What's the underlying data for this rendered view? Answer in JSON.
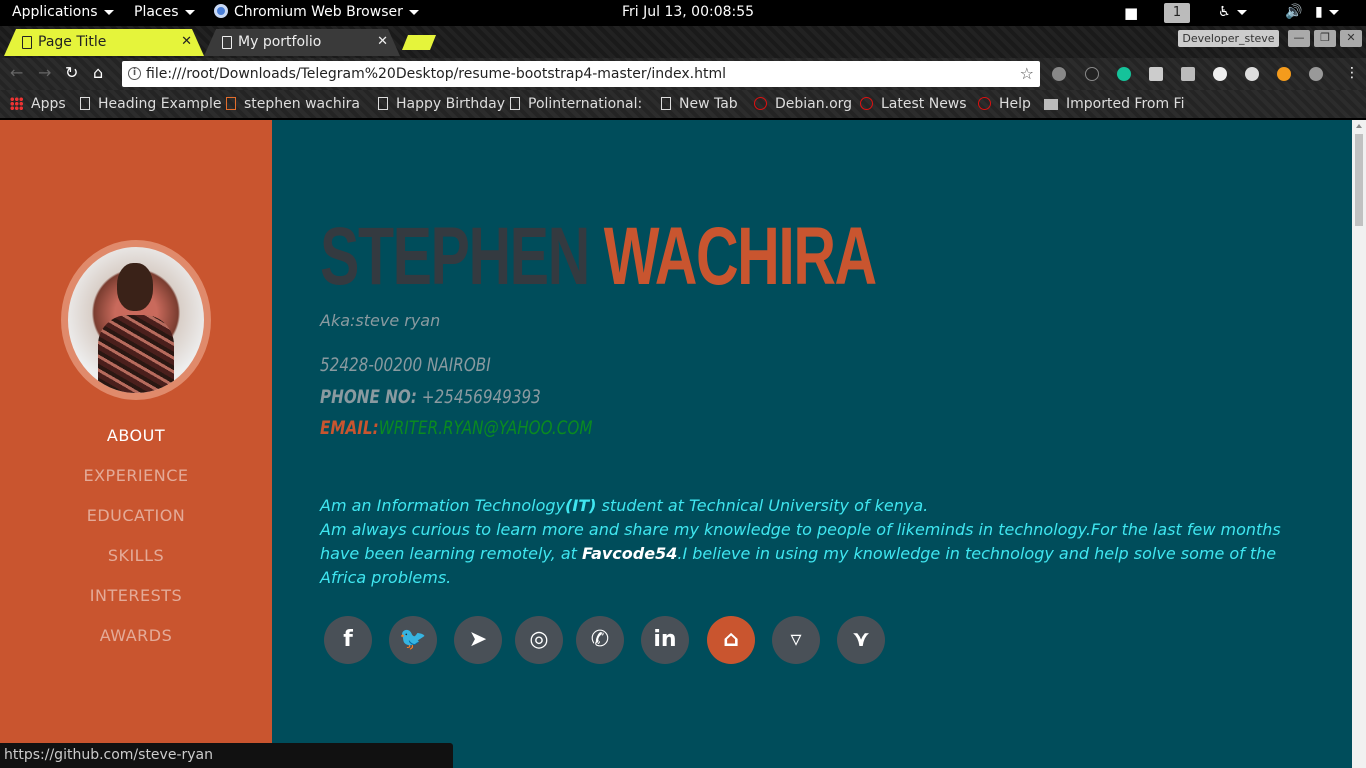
{
  "system_bar": {
    "applications": "Applications",
    "places": "Places",
    "browser": "Chromium Web Browser",
    "clock": "Fri Jul 13, 00:08:55",
    "workspace": "1"
  },
  "tabs": [
    {
      "title": "Page Title",
      "active": true
    },
    {
      "title": "My portfolio",
      "active": false
    }
  ],
  "window": {
    "profile": "Developer_steve"
  },
  "address_bar": {
    "url": "file:///root/Downloads/Telegram%20Desktop/resume-bootstrap4-master/index.html"
  },
  "bookmarks": [
    {
      "label": "Apps",
      "icon": "apps-grid-icon"
    },
    {
      "label": "Heading Example",
      "icon": "page-icon"
    },
    {
      "label": "stephen wachira",
      "icon": "gitlab-icon"
    },
    {
      "label": "Happy Birthday",
      "icon": "page-icon"
    },
    {
      "label": "Polinternational:",
      "icon": "page-icon"
    },
    {
      "label": "New Tab",
      "icon": "page-icon"
    },
    {
      "label": "Debian.org",
      "icon": "debian-icon"
    },
    {
      "label": "Latest News",
      "icon": "debian-icon"
    },
    {
      "label": "Help",
      "icon": "debian-icon"
    },
    {
      "label": "Imported From Fi",
      "icon": "folder-icon"
    }
  ],
  "sidebar": {
    "nav": [
      "ABOUT",
      "EXPERIENCE",
      "EDUCATION",
      "SKILLS",
      "INTERESTS",
      "AWARDS"
    ],
    "active": "ABOUT"
  },
  "profile": {
    "first_name": "STEPHEN",
    "last_name": "WACHIRA",
    "aka": "Aka:steve ryan",
    "address": "52428-00200 NAIROBI",
    "phone_label": "PHONE NO:",
    "phone": "+25456949393",
    "email_label": "EMAIL:",
    "email": "WRITER.RYAN@YAHOO.COM"
  },
  "bio": {
    "line1_a": "Am an Information Technology",
    "line1_b": "(IT)",
    "line1_c": " student at Technical University of kenya.",
    "line2_a": "Am always curious to learn more and share my knowledge to people of likeminds in technology.For the last few months have been learning remotely, at ",
    "line2_b": "Favcode54",
    "line2_c": ".I believe in using my knowledge in technology and help solve some of the Africa problems."
  },
  "socials": [
    {
      "icon": "facebook-icon",
      "glyph": "f"
    },
    {
      "icon": "twitter-icon",
      "glyph": "🐦"
    },
    {
      "icon": "telegram-icon",
      "glyph": "➤"
    },
    {
      "icon": "instagram-icon",
      "glyph": "◎"
    },
    {
      "icon": "whatsapp-icon",
      "glyph": "✆"
    },
    {
      "icon": "linkedin-icon",
      "glyph": "in"
    },
    {
      "icon": "github-icon",
      "glyph": "⌂"
    },
    {
      "icon": "bitbucket-icon",
      "glyph": "▿"
    },
    {
      "icon": "gitlab-icon",
      "glyph": "⋎"
    }
  ],
  "status_url": "https://github.com/steve-ryan",
  "colors": {
    "accent": "#c9552f",
    "page_bg": "#004d5b",
    "dark": "#495057",
    "bio": "#3fe6f0",
    "email": "#0a8a20"
  }
}
